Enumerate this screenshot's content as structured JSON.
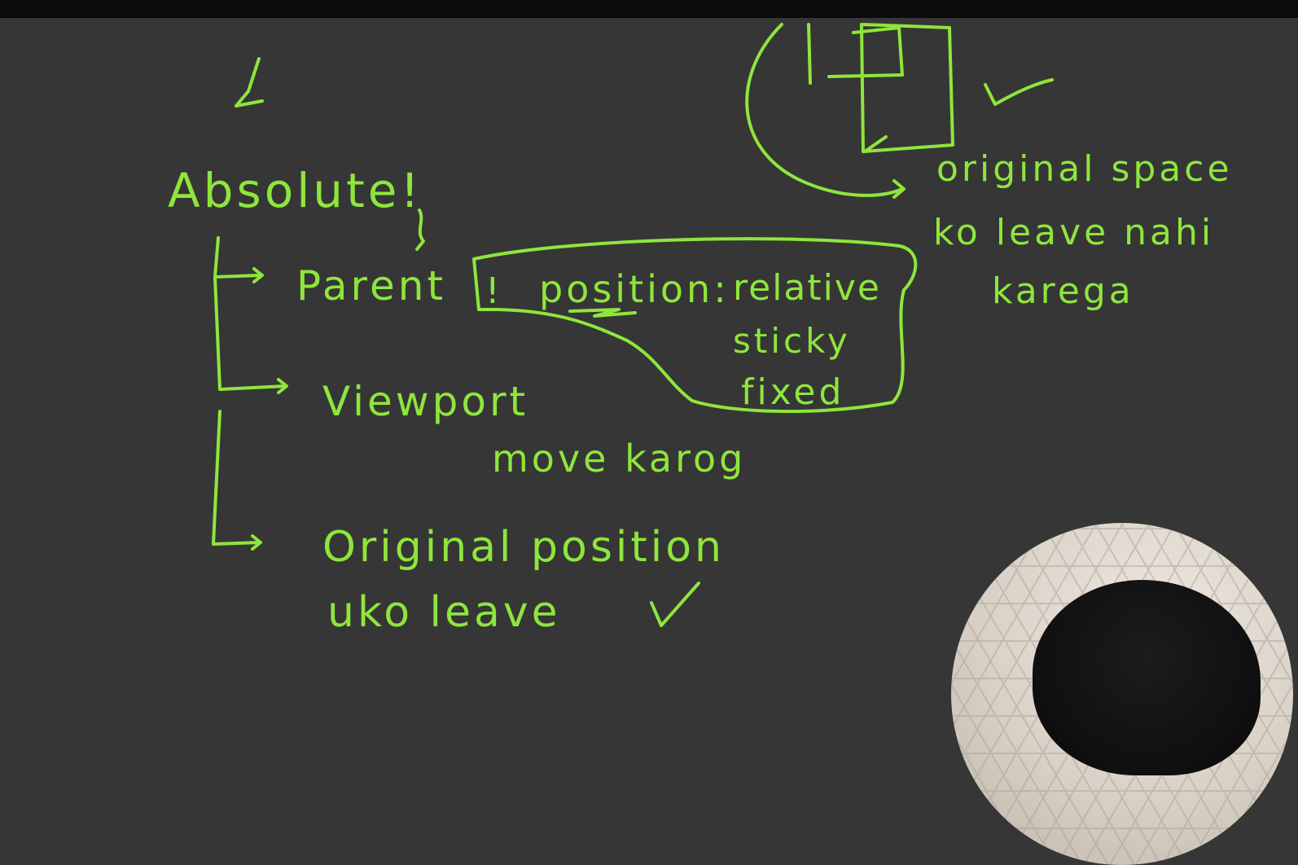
{
  "window": {
    "title": ""
  },
  "whiteboard": {
    "ink_color": "#8ee63c",
    "background": "#363636",
    "heading": "Absolute!",
    "branches": [
      {
        "label": "Parent",
        "suffix": "!"
      },
      {
        "label": "Viewport"
      },
      {
        "label": "Original position",
        "sub": "uko leave"
      }
    ],
    "position_label": "position:",
    "position_values": [
      "relative",
      "sticky",
      "fixed"
    ],
    "viewport_note": "move karog",
    "side_note": [
      "original space",
      "ko leave nahi",
      "karega"
    ]
  },
  "webcam": {
    "present": true
  }
}
